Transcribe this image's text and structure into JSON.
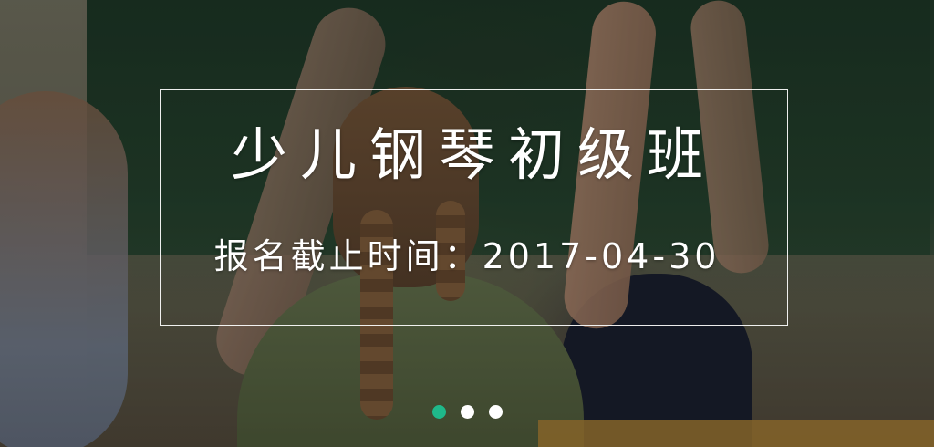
{
  "banner": {
    "title": "少儿钢琴初级班",
    "deadline": "报名截止时间：2017-04-30"
  },
  "carousel": {
    "slide_count": 3,
    "active_index": 0,
    "colors": {
      "active_dot": "#1fb88a",
      "inactive_dot": "#ffffff"
    }
  }
}
